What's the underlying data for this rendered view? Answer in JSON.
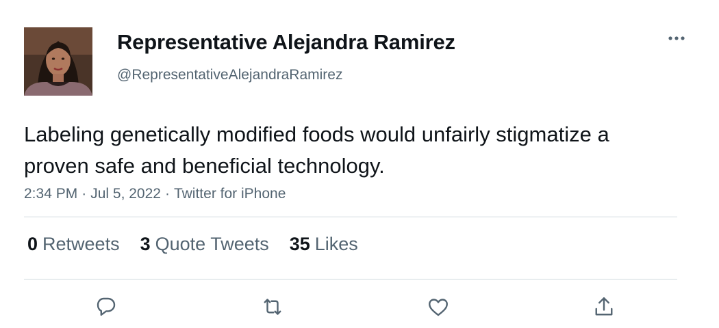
{
  "author": {
    "display_name": "Representative Alejandra Ramirez",
    "handle": "@RepresentativeAlejandraRamirez"
  },
  "tweet": {
    "text": "Labeling genetically modified foods would unfairly stigmatize a proven safe and beneficial technology.",
    "time": "2:34 PM",
    "date": "Jul 5, 2022",
    "source": "Twitter for iPhone",
    "separator": "·"
  },
  "stats": {
    "retweets_count": "0",
    "retweets_label": "Retweets",
    "quote_count": "3",
    "quote_label": "Quote Tweets",
    "likes_count": "35",
    "likes_label": "Likes"
  },
  "actions": [
    "reply-icon",
    "retweet-icon",
    "like-icon",
    "share-icon"
  ],
  "colors": {
    "text_primary": "#0f1419",
    "text_secondary": "#536471",
    "divider": "#cfd9de"
  }
}
